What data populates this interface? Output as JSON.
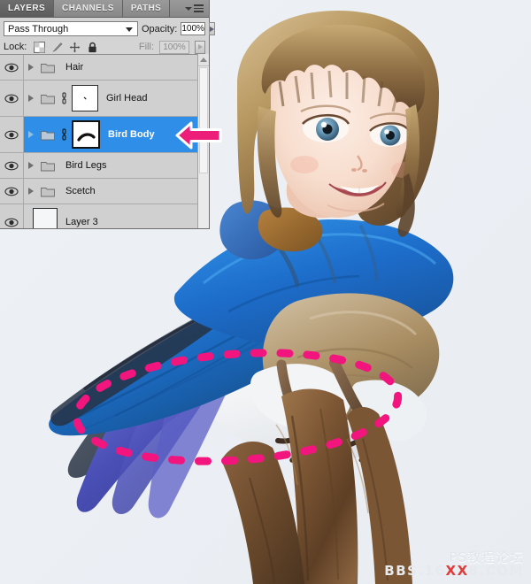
{
  "app": {
    "name": "Adobe Photoshop Layers Panel"
  },
  "panel": {
    "tabs": [
      {
        "label": "LAYERS",
        "active": true
      },
      {
        "label": "CHANNELS",
        "active": false
      },
      {
        "label": "PATHS",
        "active": false
      }
    ],
    "menu_icon": "panel-menu-icon",
    "blend_mode": {
      "value": "Pass Through",
      "arrow_icon": "chevron-down-icon"
    },
    "opacity": {
      "label": "Opacity:",
      "value": "100%",
      "stepper_icon": "right-triangle-icon"
    },
    "lock": {
      "label": "Lock:",
      "icons": [
        "transparency-lock-icon",
        "brush-lock-icon",
        "position-lock-icon",
        "all-lock-icon"
      ]
    },
    "fill": {
      "label": "Fill:",
      "value": "100%",
      "stepper_icon": "right-triangle-icon"
    },
    "layers": [
      {
        "name": "Hair",
        "visible": true,
        "type": "group",
        "selected": false,
        "has_link": false,
        "has_mask": false
      },
      {
        "name": "Girl Head",
        "visible": true,
        "type": "group",
        "selected": false,
        "has_link": true,
        "has_mask": true
      },
      {
        "name": "Bird Body",
        "visible": true,
        "type": "group",
        "selected": true,
        "has_link": true,
        "has_mask": true
      },
      {
        "name": "Bird Legs",
        "visible": true,
        "type": "group",
        "selected": false,
        "has_link": false,
        "has_mask": false
      },
      {
        "name": "Scetch",
        "visible": true,
        "type": "group",
        "selected": false,
        "has_link": false,
        "has_mask": false
      },
      {
        "name": "Layer 3",
        "visible": true,
        "type": "raster",
        "selected": false,
        "has_link": false,
        "has_mask": false
      }
    ],
    "scrollbar": {
      "up_arrow_icon": "scroll-up-arrow-icon"
    }
  },
  "annotation": {
    "arrow": {
      "icon": "pink-left-arrow-icon",
      "color": "#ec1e79",
      "points_to": "Bird Body"
    },
    "selection_marquee": {
      "icon": "dashed-ellipse-marquee",
      "color": "#f2157e",
      "style": "dashed-ellipse"
    }
  },
  "artwork": {
    "description": "Composite of a painted girl head on a blue bird body perched on a wooden branch",
    "background_color": "#eef1f5",
    "colors": {
      "bird_blue": "#1f6fd0",
      "bird_blue_light": "#2f96e8",
      "bird_wing_violet": "#4a4fb4",
      "bird_breast_tan": "#a88f6b",
      "branch_brown": "#7a5436",
      "hair_blonde": "#b89a6a",
      "hair_dark": "#6b4d31",
      "skin": "#f6ded2",
      "eye_blue": "#4e87a8",
      "shirt_blue": "#2f6fc4"
    }
  },
  "watermark": {
    "line1": "PS教程论坛",
    "line2_pre": "BBS.16",
    "line2_hl": "XX",
    "line2_post": "8.COM"
  }
}
